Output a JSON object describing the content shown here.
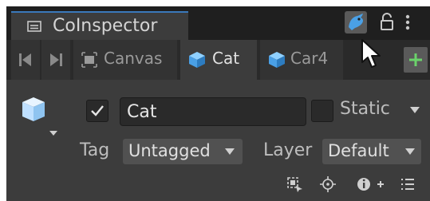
{
  "window": {
    "title": "CoInspector"
  },
  "tabs": [
    {
      "label": "Canvas",
      "icon": "canvas-icon"
    },
    {
      "label": "Cat",
      "icon": "cube-icon"
    },
    {
      "label": "Car4",
      "icon": "cube-icon"
    }
  ],
  "active_tab": "Cat",
  "header": {
    "name_value": "Cat",
    "static_label": "Static",
    "tag_label": "Tag",
    "tag_value": "Untagged",
    "layer_label": "Layer",
    "layer_value": "Default"
  },
  "colors": {
    "accent_blue": "#3a79bb",
    "icon_blue": "#4aa0e6",
    "add_green": "#6bd36b"
  }
}
